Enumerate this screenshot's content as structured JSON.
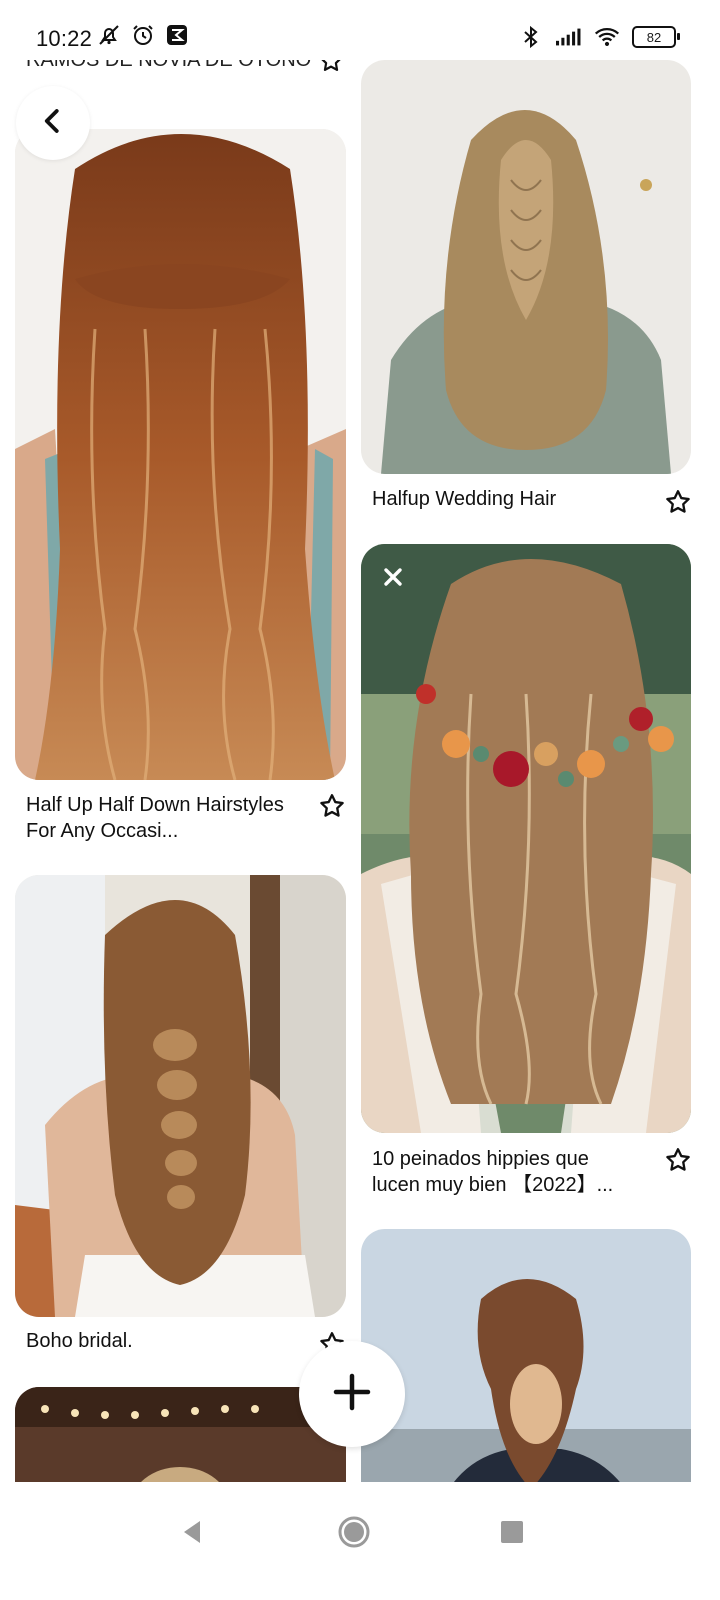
{
  "status_bar": {
    "time": "10:22",
    "battery": "82",
    "left_icons": [
      "bell-off-icon",
      "alarm-icon",
      "app-notification-icon"
    ],
    "right_icons": [
      "bluetooth-icon",
      "signal-icon",
      "wifi-icon",
      "battery-icon"
    ]
  },
  "top_cut_title": "RAMOS DE NOVIA DE OTOÑO",
  "pins": [
    {
      "id": "pin-1",
      "title": "Half Up Half Down Hairstyles For Any Occasi...",
      "icon": "star-icon"
    },
    {
      "id": "pin-2",
      "title": "Halfup Wedding Hair",
      "icon": "star-icon"
    },
    {
      "id": "pin-3",
      "title": "Boho bridal.",
      "icon": "star-icon"
    },
    {
      "id": "pin-4",
      "title": "10 peinados hippies que lucen muy bien 【2022】...",
      "icon": "star-icon"
    }
  ],
  "buttons": {
    "back_icon": "chevron-left-icon",
    "add_icon": "plus-icon",
    "hide_icon": "close-icon"
  },
  "nav_bar": [
    "nav-back-icon",
    "nav-home-icon",
    "nav-recents-icon"
  ]
}
